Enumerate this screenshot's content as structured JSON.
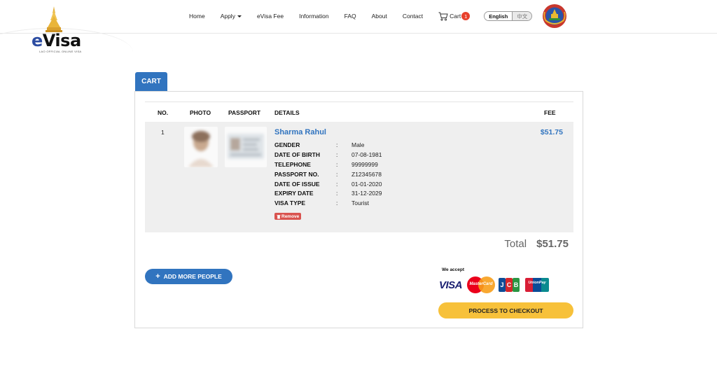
{
  "logo": {
    "brand_e": "e",
    "brand_rest": "Visa",
    "subtitle": "LAO OFFICIAL ONLINE VISA"
  },
  "nav": {
    "items": [
      "Home",
      "Apply",
      "eVisa Fee",
      "Information",
      "FAQ",
      "About",
      "Contact"
    ],
    "cart_label": "Cart",
    "cart_count": "1",
    "lang_active": "English",
    "lang_inactive": "中文"
  },
  "cart": {
    "tab_label": "CART",
    "columns": {
      "no": "NO.",
      "photo": "PHOTO",
      "passport": "PASSPORT",
      "details": "DETAILS",
      "fee": "FEE"
    },
    "items": [
      {
        "no": "1",
        "name": "Sharma Rahul",
        "fee": "$51.75",
        "remove_label": "Remove",
        "details": [
          {
            "label": "GENDER",
            "value": "Male"
          },
          {
            "label": "DATE OF BIRTH",
            "value": "07-08-1981"
          },
          {
            "label": "TELEPHONE",
            "value": "99999999"
          },
          {
            "label": "PASSPORT NO.",
            "value": "Z12345678"
          },
          {
            "label": "DATE OF ISSUE",
            "value": "01-01-2020"
          },
          {
            "label": "EXPIRY DATE",
            "value": "31-12-2029"
          },
          {
            "label": "VISA TYPE",
            "value": "Tourist"
          }
        ]
      }
    ],
    "total_label": "Total",
    "total_value": "$51.75",
    "add_more_label": "ADD MORE PEOPLE",
    "we_accept_label": "We accept",
    "cards": {
      "visa": "VISA",
      "mastercard": "MasterCard",
      "jcb": [
        "J",
        "C",
        "B"
      ],
      "unionpay": "UnionPay"
    },
    "checkout_label": "PROCESS TO CHECKOUT"
  },
  "colors": {
    "primary": "#3174bf",
    "checkout": "#f7c13a",
    "remove": "#d9534f",
    "badge": "#e8412c"
  }
}
